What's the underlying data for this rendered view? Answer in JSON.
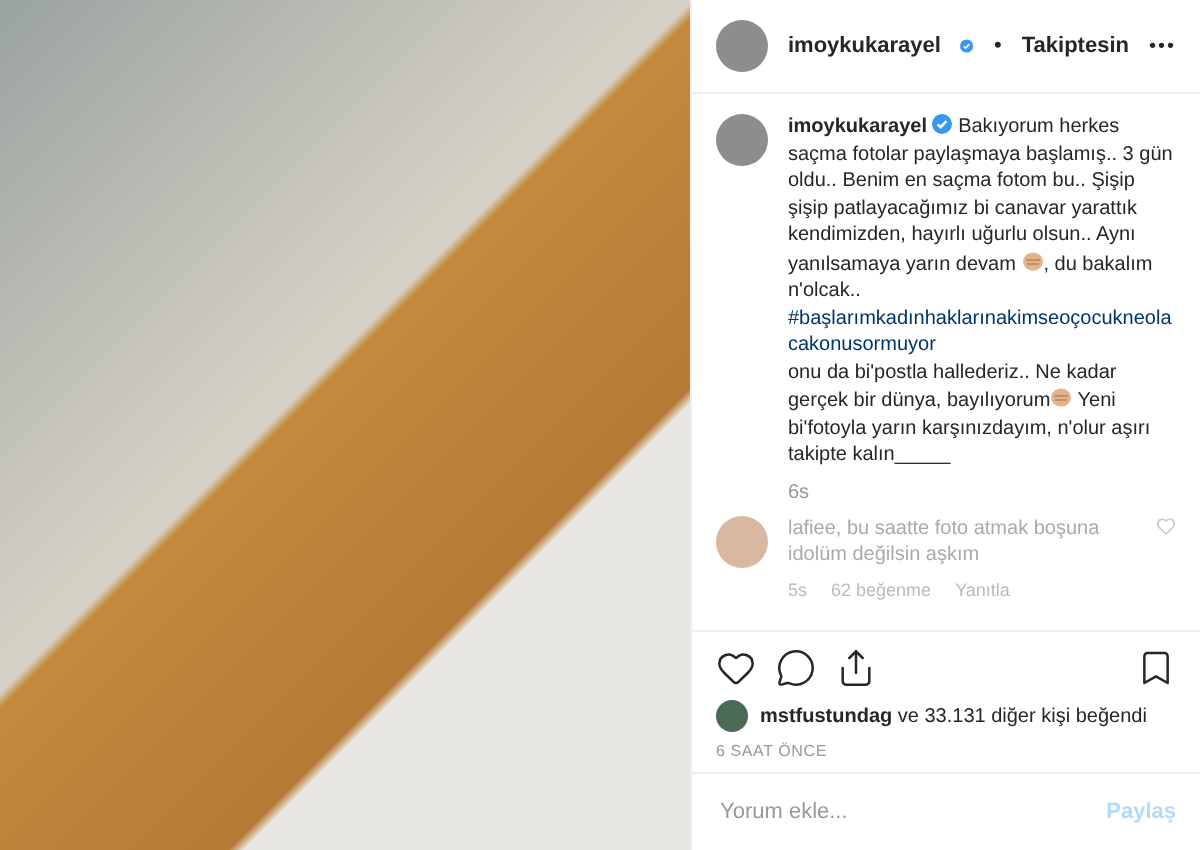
{
  "header": {
    "username": "imoykukarayel",
    "verified": true,
    "separator": "•",
    "follow_status": "Takiptesin",
    "more": "•••"
  },
  "caption": {
    "username": "imoykukarayel",
    "verified": true,
    "parts": [
      {
        "kind": "text",
        "text": "Bakıyorum herkes saçma fotolar paylaşmaya başlamış.. 3 gün oldu.. Benim en saçma fotom bu.. Şişip şişip patlayacağımız bi canavar yarattık kendimizden, hayırlı uğurlu olsun.. Aynı yanılsamaya yarın devam "
      },
      {
        "kind": "emoji"
      },
      {
        "kind": "text",
        "text": ", du bakalım n'olcak.. "
      },
      {
        "kind": "hashtag",
        "text": "#başlarımkadınhaklarınakimseoçocukneolacakonusormuyor"
      },
      {
        "kind": "text",
        "text": " onu da bi'postla hallederiz.. Ne kadar gerçek bir dünya, bayılıyorum"
      },
      {
        "kind": "emoji"
      },
      {
        "kind": "text",
        "text": " Yeni bi'fotoyla yarın karşınızdayım, n'olur aşırı takipte kalın_____"
      }
    ],
    "time": "6s"
  },
  "comments": [
    {
      "text": "lafiee, bu saatte foto atmak boşuna idolüm değilsin aşkım",
      "time": "5s",
      "likes": "62 beğenme",
      "reply": "Yanıtla",
      "liked": false
    }
  ],
  "actions": {
    "liked": false,
    "saved": false
  },
  "likes": {
    "user": "mstfustundag",
    "rest": " ve 33.131 diğer kişi beğendi"
  },
  "posted": "6 SAAT ÖNCE",
  "comment_box": {
    "placeholder": "Yorum ekle...",
    "submit": "Paylaş"
  }
}
